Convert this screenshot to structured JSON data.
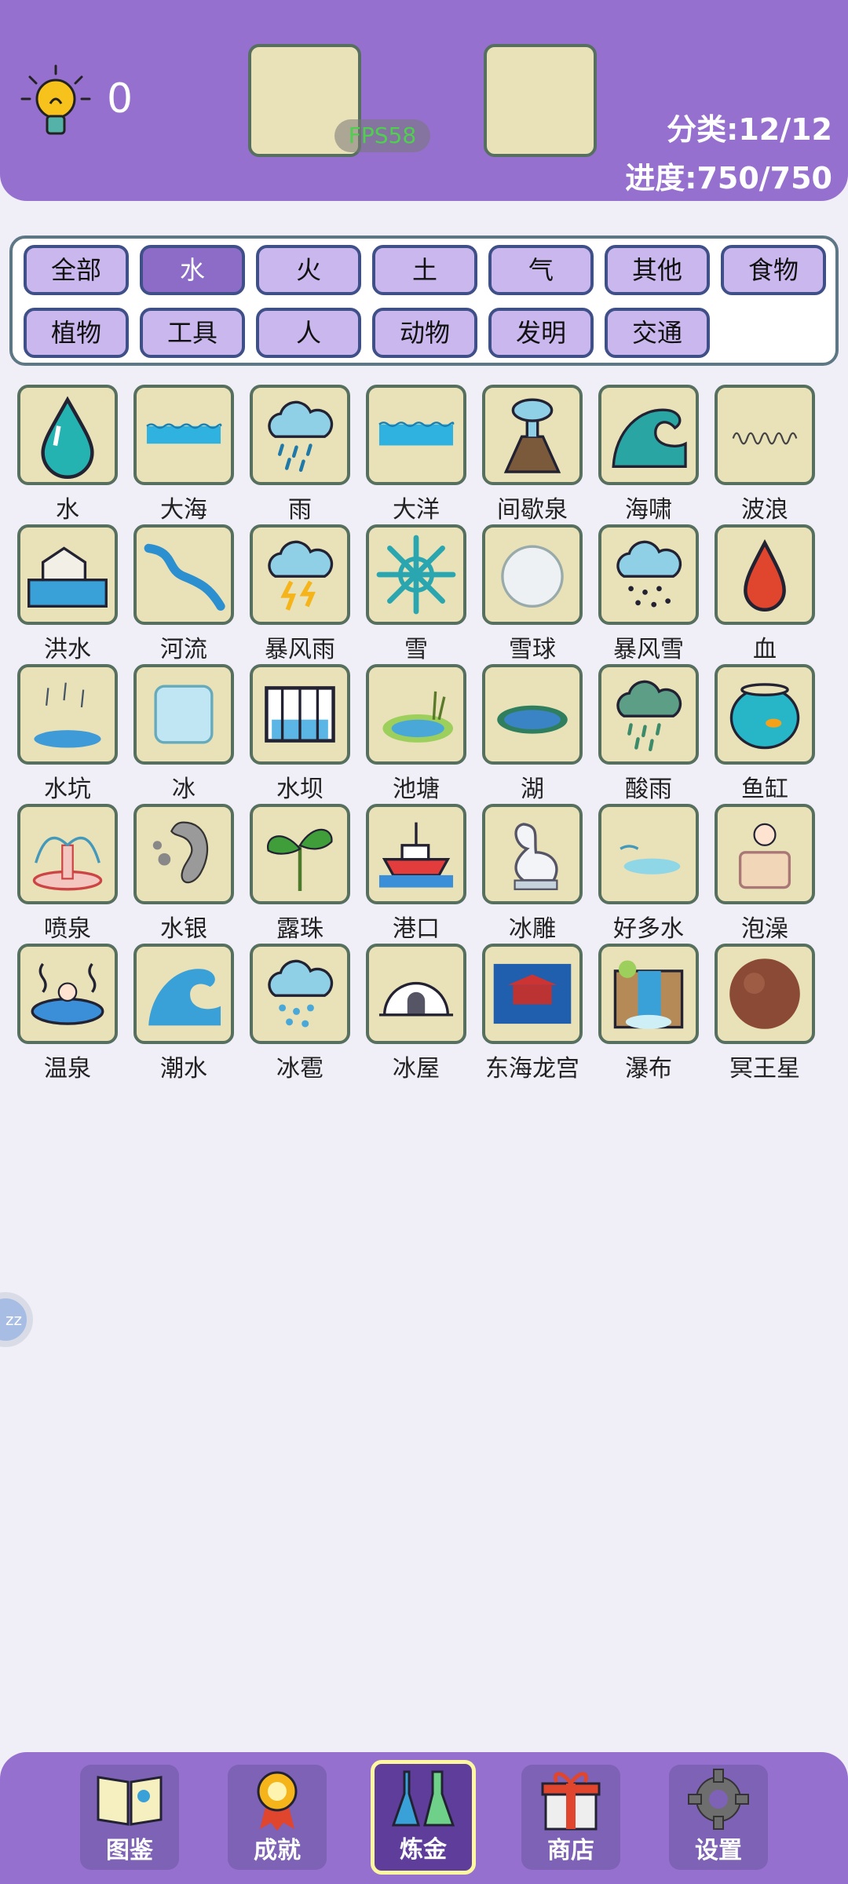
{
  "header": {
    "hint_count": "0",
    "fps": "FPS58",
    "category_progress": "分类:12/12",
    "progress": "进度:750/750"
  },
  "categories": [
    "全部",
    "水",
    "火",
    "土",
    "气",
    "其他",
    "食物",
    "植物",
    "工具",
    "人",
    "动物",
    "发明",
    "交通"
  ],
  "active_category": "水",
  "items": [
    "水",
    "大海",
    "雨",
    "大洋",
    "间歇泉",
    "海啸",
    "波浪",
    "洪水",
    "河流",
    "暴风雨",
    "雪",
    "雪球",
    "暴风雪",
    "血",
    "水坑",
    "冰",
    "水坝",
    "池塘",
    "湖",
    "酸雨",
    "鱼缸",
    "喷泉",
    "水银",
    "露珠",
    "港口",
    "冰雕",
    "好多水",
    "泡澡",
    "温泉",
    "潮水",
    "冰雹",
    "冰屋",
    "东海龙宫",
    "瀑布",
    "冥王星"
  ],
  "side_bubble": "zz",
  "nav": {
    "encyclopedia": "图鉴",
    "achievements": "成就",
    "alchemy": "炼金",
    "shop": "商店",
    "settings": "设置"
  },
  "colors": {
    "header": "#9670cf",
    "tile": "#e9e1b7",
    "category_button": "#c9b7ee",
    "category_active": "#8c6cc6"
  },
  "icons": [
    "lightbulb-icon",
    "water-drop-icon",
    "sea-icon",
    "rain-cloud-icon",
    "ocean-icon",
    "geyser-icon",
    "tsunami-icon",
    "wave-icon",
    "flood-icon",
    "river-icon",
    "storm-icon",
    "snowflake-icon",
    "snowball-icon",
    "blizzard-icon",
    "blood-drop-icon",
    "puddle-icon",
    "ice-cube-icon",
    "dam-icon",
    "pond-icon",
    "lake-icon",
    "acid-rain-icon",
    "fishbowl-icon",
    "fountain-icon",
    "mercury-icon",
    "dew-plant-icon",
    "harbor-ship-icon",
    "ice-swan-icon",
    "lots-of-water-icon",
    "bath-icon",
    "hot-spring-icon",
    "tide-icon",
    "hail-icon",
    "igloo-icon",
    "dragon-palace-icon",
    "waterfall-icon",
    "pluto-icon",
    "book-icon",
    "medal-icon",
    "flask-icon",
    "gift-icon",
    "gear-icon"
  ]
}
